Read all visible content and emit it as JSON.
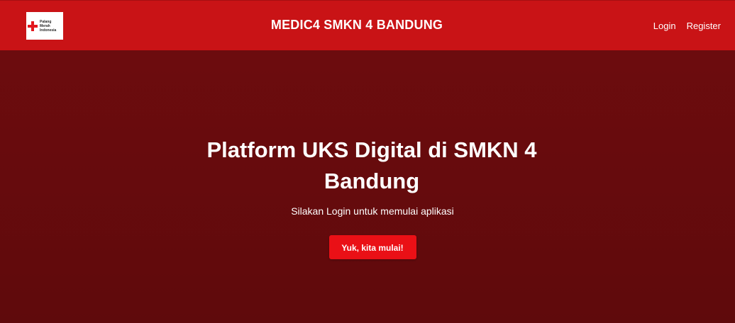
{
  "nav": {
    "logo_lines": [
      "Palang",
      "Merah",
      "Indonesia"
    ],
    "brand_title": "MEDIC4 SMKN 4 BANDUNG",
    "login_label": "Login",
    "register_label": "Register"
  },
  "hero": {
    "title": "Platform UKS Digital di SMKN 4 Bandung",
    "subtitle": "Silakan Login untuk memulai aplikasi",
    "cta_label": "Yuk, kita mulai!"
  },
  "colors": {
    "navbar": "#c91316",
    "hero_background": "#6f0c0e",
    "cta": "#ea1016",
    "logo_cross": "#e2171d"
  },
  "icons": {
    "logo": "red-cross-icon"
  }
}
